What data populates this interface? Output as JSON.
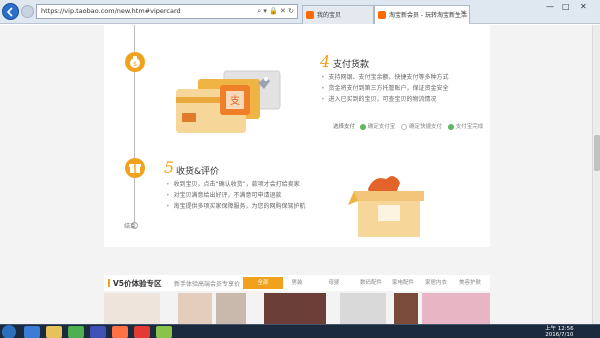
{
  "browser": {
    "url": "https://vip.taobao.com/new.htm#vipercard",
    "tabs": [
      {
        "label": "我的宝贝"
      },
      {
        "label": "淘宝新会员 - 玩转淘宝新生活"
      }
    ],
    "window_controls": [
      "—",
      "□",
      "✕"
    ]
  },
  "steps": [
    {
      "number": "4",
      "title": "支付货款",
      "bullets": [
        "支持网银、支付宝余额、快捷支付等多种方式",
        "货金将支付到第三方托管账户，保证资金安全",
        "进入已买到的宝贝，可查宝贝的物流情况"
      ],
      "pay_label": "选择支付",
      "pay_options": [
        "确定支付宝",
        "确定快捷支付",
        "支付宝完成"
      ]
    },
    {
      "number": "5",
      "title": "收货&评价",
      "bullets": [
        "收到宝贝，点击“确认收货”，款项才会打给卖家",
        "对宝贝满意给出好评，不满意可申请退款",
        "淘宝提供多项买家保障服务，为您的网购保驾护航"
      ]
    }
  ],
  "timeline_end": "结束",
  "v5": {
    "title": "V5价体验专区",
    "subtitle": "新手体验高端会员专享价",
    "categories": [
      "全部",
      "男装",
      "母婴",
      "数码配件",
      "家电配件",
      "家居内衣",
      "美容护肤"
    ],
    "active_index": 0
  },
  "taskbar": {
    "time": "上午 12:56",
    "date": "2016/7/10"
  },
  "colors": {
    "accent": "#f1a21c",
    "check": "#5cb85c"
  }
}
